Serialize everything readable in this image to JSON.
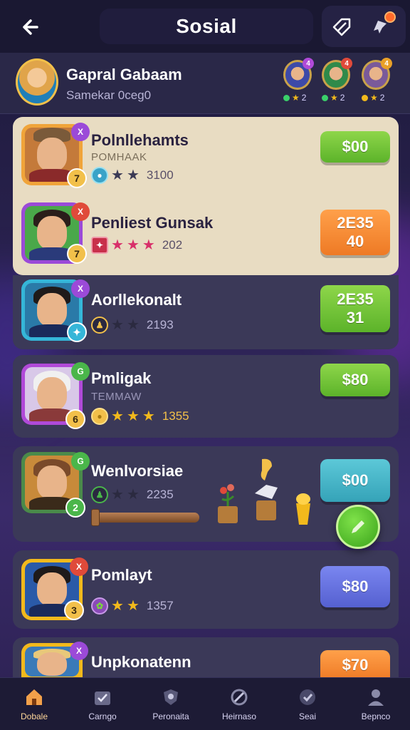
{
  "header": {
    "title": "Sosial",
    "back_icon": "arrow-left-icon",
    "action_icons": [
      "tag-icon",
      "pin-icon"
    ]
  },
  "profile": {
    "name": "Gapral Gabaam",
    "subtitle": "Samekar 0ceg0",
    "friends": [
      {
        "badge": "4",
        "stats": "2",
        "badge_color": "#b04ad8"
      },
      {
        "badge": "4",
        "stats": "2",
        "badge_color": "#e04a3a"
      },
      {
        "badge": "4",
        "stats": "2",
        "badge_color": "#e9a028"
      }
    ]
  },
  "players": [
    {
      "name": "Polnllehamts",
      "tag": "POMHAAK",
      "corner": "X",
      "rank": "7",
      "score": "3100",
      "stars_on": 0,
      "button_line1": "$00",
      "button_line2": "",
      "button_color": "green"
    },
    {
      "name": "Penliest Gunsak",
      "tag": "",
      "corner": "X",
      "rank": "7",
      "score": "202",
      "stars_on": 3,
      "button_line1": "2E35",
      "button_line2": "40",
      "button_color": "orange"
    },
    {
      "name": "Aorllekonalt",
      "tag": "",
      "corner": "X",
      "rank": "",
      "score": "2193",
      "stars_on": 0,
      "button_line1": "2E35",
      "button_line2": "31",
      "button_color": "green"
    },
    {
      "name": "Pmligak",
      "tag": "TEMMAW",
      "corner": "G",
      "rank": "6",
      "score": "1355",
      "stars_on": 3,
      "button_line1": "$80",
      "button_line2": "",
      "button_color": "green"
    },
    {
      "name": "Wenlvorsiae",
      "tag": "",
      "corner": "G",
      "rank": "2",
      "score": "2235",
      "stars_on": 0,
      "button_line1": "$00",
      "button_line2": "",
      "button_color": "teal"
    },
    {
      "name": "Pomlayt",
      "tag": "",
      "corner": "X",
      "rank": "3",
      "score": "1357",
      "stars_on": 2,
      "button_line1": "$80",
      "button_line2": "",
      "button_color": "blue"
    },
    {
      "name": "Unpkonatenn",
      "tag": "",
      "corner": "X",
      "rank": "",
      "score": "",
      "stars_on": 0,
      "button_line1": "$70",
      "button_line2": "",
      "button_color": "orange"
    }
  ],
  "nav": [
    {
      "label": "Dobale",
      "icon": "home-icon",
      "active": true
    },
    {
      "label": "Carngo",
      "icon": "calendar-check-icon",
      "active": false
    },
    {
      "label": "Peronaita",
      "icon": "shield-icon",
      "active": false
    },
    {
      "label": "Heirnaso",
      "icon": "target-icon",
      "active": false
    },
    {
      "label": "Seai",
      "icon": "badge-icon",
      "active": false
    },
    {
      "label": "Bepnco",
      "icon": "user-icon",
      "active": false
    }
  ],
  "colors": {
    "green": "#6cc43a",
    "orange": "#f08a30",
    "teal": "#45b6c8",
    "blue": "#6570e0",
    "panel_light": "#e8dcc2",
    "panel_dark": "#3b3958"
  }
}
